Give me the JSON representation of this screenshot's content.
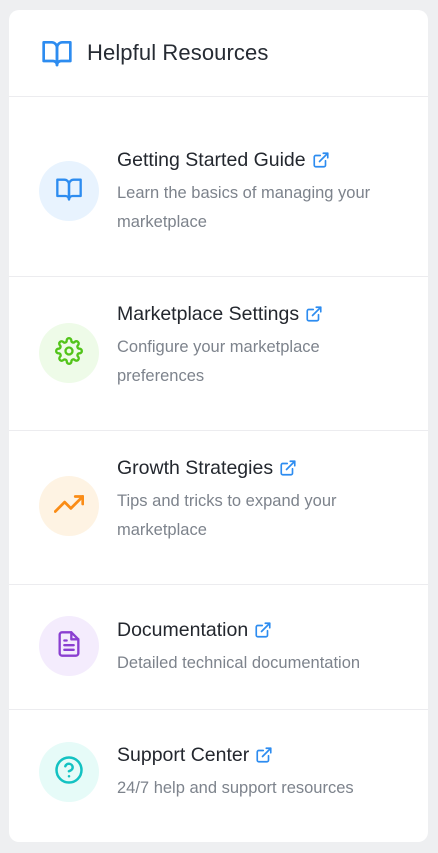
{
  "panel": {
    "title": "Helpful Resources",
    "icon": "open-book-icon"
  },
  "resources": [
    {
      "title": "Getting Started Guide",
      "description": "Learn the basics of managing your marketplace",
      "icon": "book-icon",
      "icon_color": "#2d8cf0",
      "bg_color": "#e8f3fe"
    },
    {
      "title": "Marketplace Settings",
      "description": "Configure your marketplace preferences",
      "icon": "gear-icon",
      "icon_color": "#52c41a",
      "bg_color": "#eefbe8"
    },
    {
      "title": "Growth Strategies",
      "description": "Tips and tricks to expand your marketplace",
      "icon": "trending-up-icon",
      "icon_color": "#fa8c16",
      "bg_color": "#fef3e3"
    },
    {
      "title": "Documentation",
      "description": "Detailed technical documentation",
      "icon": "document-icon",
      "icon_color": "#8a3fd1",
      "bg_color": "#f4ecfd"
    },
    {
      "title": "Support Center",
      "description": "24/7 help and support resources",
      "icon": "help-circle-icon",
      "icon_color": "#13c2c2",
      "bg_color": "#e6fbf8"
    }
  ],
  "colors": {
    "accent": "#2d8cf0",
    "external_link": "#2d8cf0"
  }
}
